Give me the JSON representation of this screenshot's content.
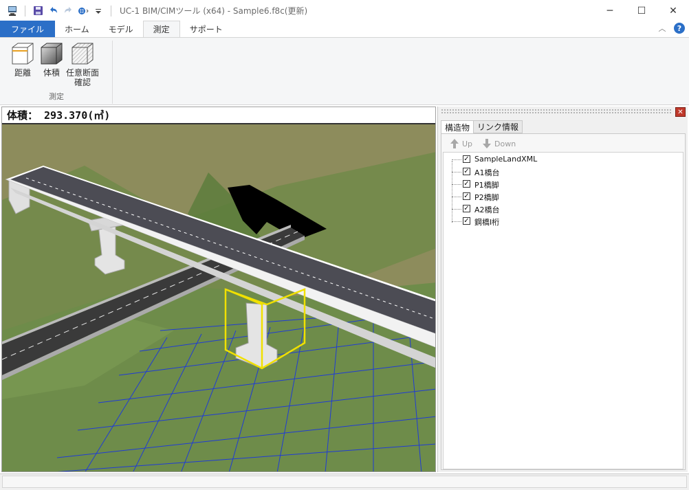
{
  "window": {
    "title": "UC-1 BIM/CIMツール (x64) - Sample6.f8c(更新)",
    "controls": {
      "minimize": "─",
      "maximize": "☐",
      "close": "✕"
    }
  },
  "ribbon": {
    "tabs": [
      {
        "label": "ファイル"
      },
      {
        "label": "ホーム"
      },
      {
        "label": "モデル"
      },
      {
        "label": "測定"
      },
      {
        "label": "サポート"
      }
    ],
    "active_tab": "測定",
    "help_label": "?",
    "collapse_label": "︿",
    "groups": [
      {
        "label": "測定",
        "buttons": [
          {
            "label": "距離"
          },
          {
            "label": "体積"
          },
          {
            "label": "任意断面",
            "label2": "確認"
          }
        ]
      }
    ]
  },
  "viewport": {
    "measurement": "体積： 293.370(㎥)"
  },
  "panel": {
    "close_label": "✕",
    "tabs": [
      {
        "label": "構造物"
      },
      {
        "label": "リンク情報"
      }
    ],
    "up_label": "Up",
    "down_label": "Down",
    "tree": [
      {
        "label": "SampleLandXML",
        "checked": true
      },
      {
        "label": "A1橋台",
        "checked": true
      },
      {
        "label": "P1橋脚",
        "checked": true
      },
      {
        "label": "P2橋脚",
        "checked": true
      },
      {
        "label": "A2橋台",
        "checked": true
      },
      {
        "label": "鋼橋I桁",
        "checked": true
      }
    ]
  },
  "colors": {
    "accent": "#2b6fc7",
    "selection_box": "#f0e000",
    "grid": "#1f3bd6",
    "terrain": "#8a8a5a"
  }
}
